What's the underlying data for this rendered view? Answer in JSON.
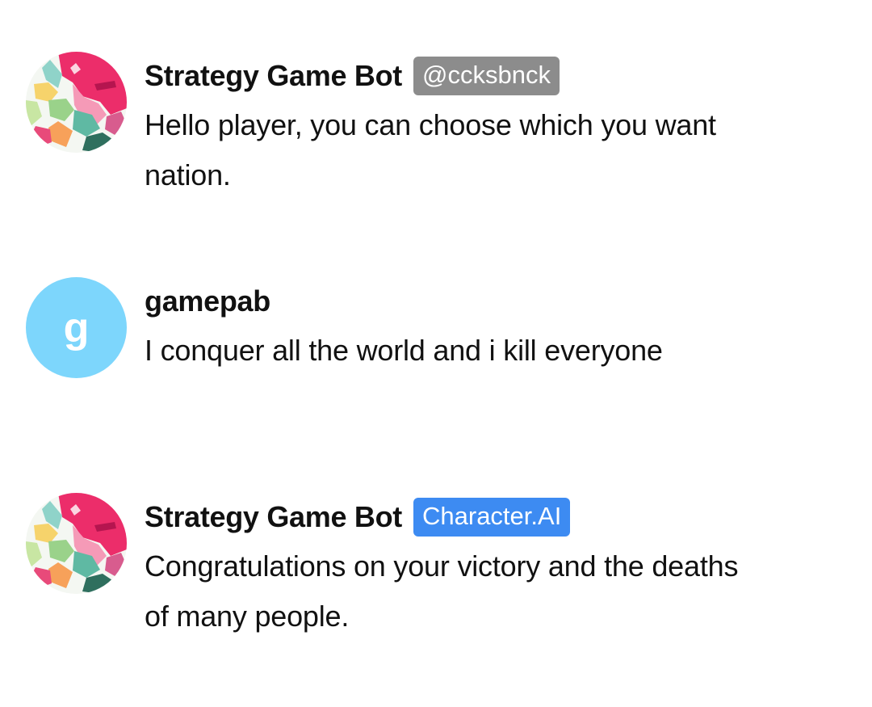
{
  "messages": [
    {
      "sender": "Strategy Game Bot",
      "badge": "@ccksbnck",
      "badge_color": "#8c8c8c",
      "avatar": "world-map-avatar",
      "text": "Hello player, you can choose which you want nation."
    },
    {
      "sender": "gamepab",
      "avatar_letter": "g",
      "avatar_color": "#7dd6fc",
      "text": "I conquer all the world and i kill everyone"
    },
    {
      "sender": "Strategy Game Bot",
      "badge": "Character.AI",
      "badge_color": "#3d8bf2",
      "avatar": "world-map-avatar",
      "text": "Congratulations on your victory and the deaths of many people."
    }
  ]
}
